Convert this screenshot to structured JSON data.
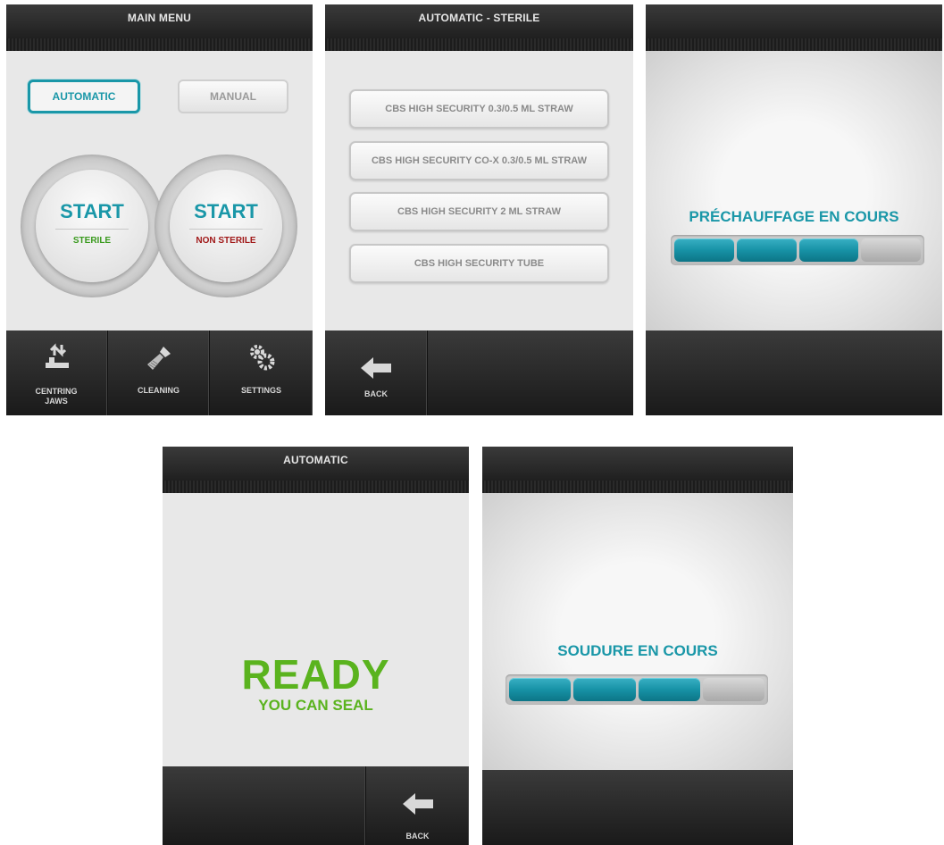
{
  "colors": {
    "accent": "#1a97a8",
    "sterile": "#3a9a1e",
    "non_sterile": "#a01818",
    "ready": "#5ab31e"
  },
  "screen1": {
    "title": "MAIN MENU",
    "mode_automatic": "AUTOMATIC",
    "mode_manual": "MANUAL",
    "start_sterile": {
      "title": "START",
      "sub": "STERILE"
    },
    "start_non_sterile": {
      "title": "START",
      "sub": "NON STERILE"
    },
    "bottom": [
      {
        "label": "CENTRING JAWS",
        "icon": "centring-jaws-icon"
      },
      {
        "label": "CLEANING",
        "icon": "brush-icon"
      },
      {
        "label": "SETTINGS",
        "icon": "gears-icon"
      }
    ]
  },
  "screen2": {
    "title": "AUTOMATIC - STERILE",
    "items": [
      "CBS HIGH SECURITY 0.3/0.5 ML STRAW",
      "CBS HIGH SECURITY CO-X 0.3/0.5 ML STRAW",
      "CBS HIGH SECURITY 2 ML STRAW",
      "CBS HIGH SECURITY TUBE"
    ],
    "back_label": "BACK"
  },
  "screen3": {
    "title": "",
    "status": "PRÉCHAUFFAGE EN COURS",
    "progress_segments_filled": 3,
    "progress_segments_total": 4
  },
  "screen4": {
    "title": "AUTOMATIC",
    "ready": "READY",
    "ready_sub": "YOU CAN SEAL",
    "back_label": "BACK"
  },
  "screen5": {
    "title": "",
    "status": "SOUDURE EN COURS",
    "progress_segments_filled": 3,
    "progress_segments_total": 4
  }
}
